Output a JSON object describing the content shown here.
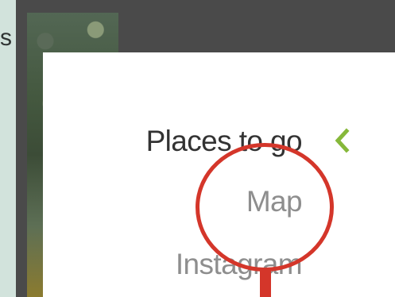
{
  "left_edge_text": "s",
  "menu": {
    "items": [
      {
        "label": "Places to go",
        "active": true,
        "expanded": true
      },
      {
        "label": "Map",
        "active": false
      },
      {
        "label": "Instagram",
        "active": false
      }
    ]
  },
  "icons": {
    "expand_indicator": "chevron-left-icon"
  },
  "colors": {
    "background": "#d2e3dc",
    "frame": "#4a4a4a",
    "menu_background": "#ffffff",
    "active_text": "#333333",
    "inactive_text": "#8e8e8e",
    "chevron": "#86b83a",
    "annotation": "#d4362a"
  }
}
